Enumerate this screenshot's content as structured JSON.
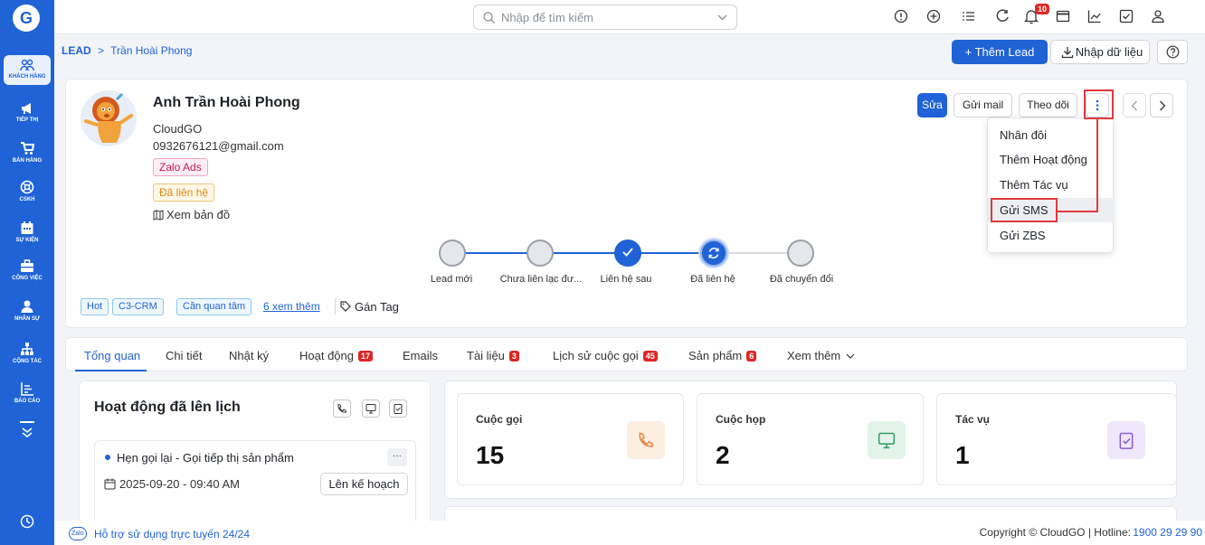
{
  "topbar": {
    "search_placeholder": "Nhập để tìm kiếm",
    "notif_count": "10"
  },
  "sidebar": {
    "items": [
      {
        "label": "KHÁCH HÀNG",
        "icon": "customers-icon"
      },
      {
        "label": "TIẾP THỊ",
        "icon": "megaphone-icon"
      },
      {
        "label": "BÁN HÀNG",
        "icon": "cart-icon"
      },
      {
        "label": "CSKH",
        "icon": "support-icon"
      },
      {
        "label": "SỰ KIỆN",
        "icon": "calendar-icon"
      },
      {
        "label": "CÔNG VIỆC",
        "icon": "briefcase-icon"
      },
      {
        "label": "NHÂN SỰ",
        "icon": "person-icon"
      },
      {
        "label": "CỘNG TÁC",
        "icon": "org-chart-icon"
      },
      {
        "label": "BÁO CÁO",
        "icon": "report-icon"
      }
    ]
  },
  "breadcrumb": {
    "root": "LEAD",
    "sep": ">",
    "current": "Trần Hoài Phong"
  },
  "header_actions": {
    "add_lead": "+ Thêm Lead",
    "import": "Nhập dữ liệu"
  },
  "profile": {
    "name": "Anh Trần Hoài Phong",
    "company": "CloudGO",
    "email": "0932676121@gmail.com",
    "source_tag": "Zalo Ads",
    "status_tag": "Đã liên hệ",
    "map_link": "Xem bản đồ"
  },
  "actions": {
    "edit": "Sửa",
    "send_mail": "Gửi mail",
    "follow": "Theo dõi"
  },
  "dropdown": {
    "items": [
      "Nhân đôi",
      "Thêm Hoạt động",
      "Thêm Tác vụ",
      "Gửi SMS",
      "Gửi ZBS"
    ],
    "highlighted": "Gửi SMS"
  },
  "pipeline": {
    "steps": [
      {
        "label": "Lead mới",
        "state": "todo"
      },
      {
        "label": "Chưa liên lạc đư...",
        "state": "todo"
      },
      {
        "label": "Liên hệ sau",
        "state": "done"
      },
      {
        "label": "Đã liên hệ",
        "state": "current"
      },
      {
        "label": "Đã chuyển đổi",
        "state": "todo"
      }
    ]
  },
  "tags": {
    "items": [
      "Hot",
      "C3-CRM",
      "Cần quan tâm"
    ],
    "more": "6 xem thêm",
    "assign": "Gán Tag"
  },
  "tabs": [
    {
      "label": "Tổng quan",
      "count": ""
    },
    {
      "label": "Chi tiết",
      "count": ""
    },
    {
      "label": "Nhật ký",
      "count": ""
    },
    {
      "label": "Hoạt động",
      "count": "17"
    },
    {
      "label": "Emails",
      "count": ""
    },
    {
      "label": "Tài liệu",
      "count": "3"
    },
    {
      "label": "Lịch sử cuộc gọi",
      "count": "45"
    },
    {
      "label": "Sản phẩm",
      "count": "6"
    },
    {
      "label": "Xem thêm",
      "count": ""
    }
  ],
  "schedule": {
    "title": "Hoạt động đã lên lịch",
    "item_title": "Hẹn gọi lại - Gọi tiếp thị sản phẩm",
    "item_datetime": "2025-09-20 - 09:40 AM",
    "plan_button": "Lên kế hoạch",
    "more_label": "···"
  },
  "stats": [
    {
      "label": "Cuộc gọi",
      "value": "15",
      "icon": "phone-icon",
      "color": "#e8843a"
    },
    {
      "label": "Cuộc họp",
      "value": "2",
      "icon": "monitor-icon",
      "color": "#2e9b62"
    },
    {
      "label": "Tác vụ",
      "value": "1",
      "icon": "clipboard-icon",
      "color": "#8a5cd6"
    }
  ],
  "footer": {
    "zalo_badge": "Zalo",
    "support": "Hỗ trợ sử dụng trực tuyến 24/24",
    "copyright": "Copyright © CloudGO | Hotline:",
    "hotline": "1900 29 29 90"
  },
  "colors": {
    "primary": "#1f63d6",
    "danger": "#e02424",
    "highlight_border": "#e0393e"
  }
}
